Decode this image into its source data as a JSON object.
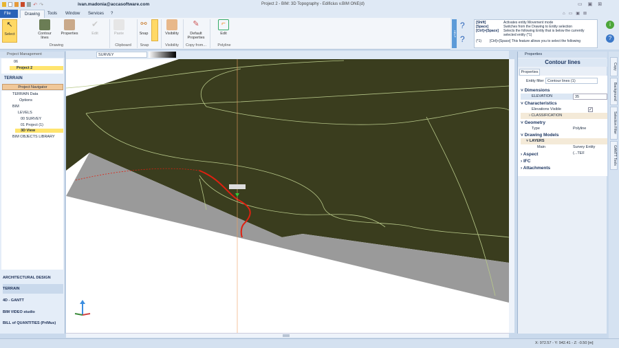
{
  "titlebar": {
    "user": "ivan.madonia@accasoftware.com",
    "title": "Project 2 - BIM: 3D Topography - Edificius v.BIM ONE(d)"
  },
  "tabs": [
    "File",
    "Drawing",
    "Tools",
    "Window",
    "Services",
    "?"
  ],
  "ribbon": {
    "buttons": {
      "select": "Select",
      "contour": "Contour lines",
      "properties": "Properties",
      "edit": "Edit",
      "paste": "Paste",
      "snap": "Snap",
      "visibility": "Visibility",
      "default_props": "Default Properties",
      "edit_polyline": "Edit"
    },
    "groups": {
      "drawing": "Drawing",
      "clipboard": "Clipboard",
      "snap": "Snap",
      "visibility": "Visibility",
      "copy_from": "Copy from...",
      "polyline": "Polyline"
    }
  },
  "help": {
    "label": "HELP",
    "rows": [
      {
        "key": "[Shift]",
        "text": "Activates entity Movement mode"
      },
      {
        "key": "[Space]",
        "text": "Switches from the Drawing to Entity selection"
      },
      {
        "key": "[Ctrl]+[Space]",
        "text": "Selects the following Entity that is below the currently selected entity (*1)"
      },
      {
        "key": "(*1)",
        "text": "[Ctrl]+[Space] This feature allows you to select the following"
      }
    ]
  },
  "project_management": {
    "title": "Project Management",
    "items": [
      "06",
      "Project 2"
    ],
    "section": "TERRAIN",
    "navigator": "Project Navigator",
    "tree": [
      "TERRAIN Data",
      "Options",
      "BIM",
      "LEVELS",
      "00 SURVEY",
      "01 Project (1)",
      "3D View",
      "BIM OBJECTS LIBRARY"
    ]
  },
  "modules": [
    "ARCHITECTURAL DESIGN",
    "TERRAIN",
    "4D - GANTT",
    "BIM VIDEO studio",
    "BILL of QUANTITIES (PriMus)"
  ],
  "view_toolbar": {
    "level": "SURVEY"
  },
  "properties": {
    "panel_title": "Properties",
    "header": "Contour lines",
    "tab": "Properties",
    "entity_filter_label": "Entity filter",
    "entity_filter_value": "Contour lines (1)",
    "dimensions": "Dimensions",
    "elevation_label": "ELEVATION",
    "elevation_value": "35",
    "characteristics": "Characteristics",
    "elev_visible_label": "Elevations Visible",
    "elev_visible": true,
    "classification": "CLASSIFICATION",
    "geometry": "Geometry",
    "type_label": "Type",
    "type_value": "Polyline",
    "drawing_models": "Drawing Models",
    "layers": "LAYERS",
    "main_label": "Main",
    "main_value": "Survey Entity   (...TEF",
    "aspect": "Aspect",
    "ifc": "IFC",
    "attachments": "Attachments"
  },
  "side_tabs": [
    "Copy",
    "Background",
    "Selection Filter",
    "GANTT Tools"
  ],
  "status": {
    "coords": "X: 972.57 - Y: 942.41 - Z: -0.50 [m]"
  },
  "colors": {
    "terrain": "#3a3d1e",
    "section": "#9a9a9a",
    "selected_polyline": "#e02010",
    "contour": "#b8c98a",
    "accent": "#ffe46e"
  }
}
